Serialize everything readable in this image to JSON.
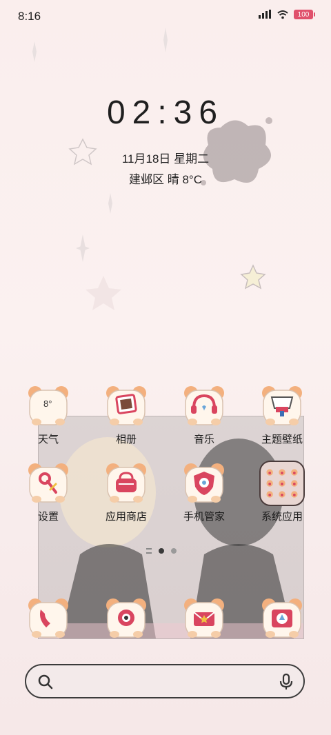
{
  "status_bar": {
    "time": "8:16",
    "battery": "100",
    "battery_color": "#e0516c"
  },
  "clock_widget": {
    "time": "02:36",
    "date": "11月18日 星期二",
    "weather": "建邺区 晴 8°C"
  },
  "apps_row1": [
    {
      "label": "天气",
      "badge": "8°",
      "icon": "weather-icon"
    },
    {
      "label": "相册",
      "icon": "photos-icon"
    },
    {
      "label": "音乐",
      "icon": "music-icon"
    },
    {
      "label": "主题壁纸",
      "icon": "themes-icon"
    }
  ],
  "apps_row2": [
    {
      "label": "设置",
      "icon": "settings-icon"
    },
    {
      "label": "应用商店",
      "icon": "app-store-icon"
    },
    {
      "label": "手机管家",
      "icon": "phone-manager-icon"
    },
    {
      "label": "系统应用",
      "icon": "system-apps-folder-icon"
    }
  ],
  "dock": [
    {
      "icon": "phone-icon"
    },
    {
      "icon": "camera-icon"
    },
    {
      "icon": "messages-icon"
    },
    {
      "icon": "browser-icon"
    }
  ],
  "page_indicator": {
    "pages": 2,
    "current": 1
  },
  "colors": {
    "accent": "#e0516c",
    "hamster_body": "#fff6ec",
    "hamster_ear": "#f3b07e"
  }
}
